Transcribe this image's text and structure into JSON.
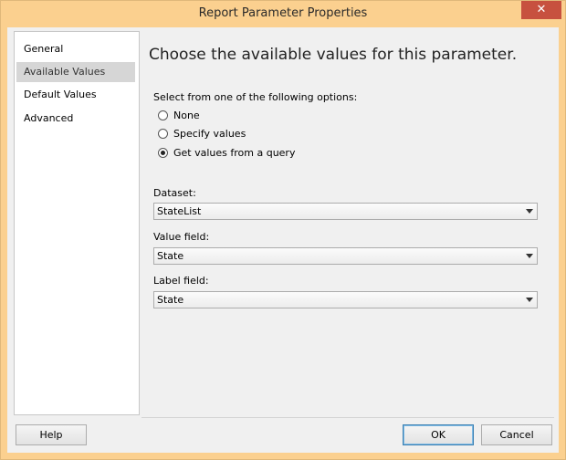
{
  "window": {
    "title": "Report Parameter Properties",
    "close_glyph": "✕"
  },
  "nav": {
    "items": [
      {
        "label": "General",
        "selected": false
      },
      {
        "label": "Available Values",
        "selected": true
      },
      {
        "label": "Default Values",
        "selected": false
      },
      {
        "label": "Advanced",
        "selected": false
      }
    ]
  },
  "content": {
    "heading": "Choose the available values for this parameter.",
    "options_label": "Select from one of the following options:",
    "options": [
      {
        "label": "None",
        "checked": false
      },
      {
        "label": "Specify values",
        "checked": false
      },
      {
        "label": "Get values from a query",
        "checked": true
      }
    ],
    "dataset": {
      "label": "Dataset:",
      "value": "StateList"
    },
    "value_field": {
      "label": "Value field:",
      "value": "State"
    },
    "label_field": {
      "label": "Label field:",
      "value": "State"
    }
  },
  "buttons": {
    "help": "Help",
    "ok": "OK",
    "cancel": "Cancel"
  },
  "colors": {
    "titlebar": "#fbd08f",
    "close": "#c7513f",
    "selected_nav": "#d6d6d6"
  }
}
